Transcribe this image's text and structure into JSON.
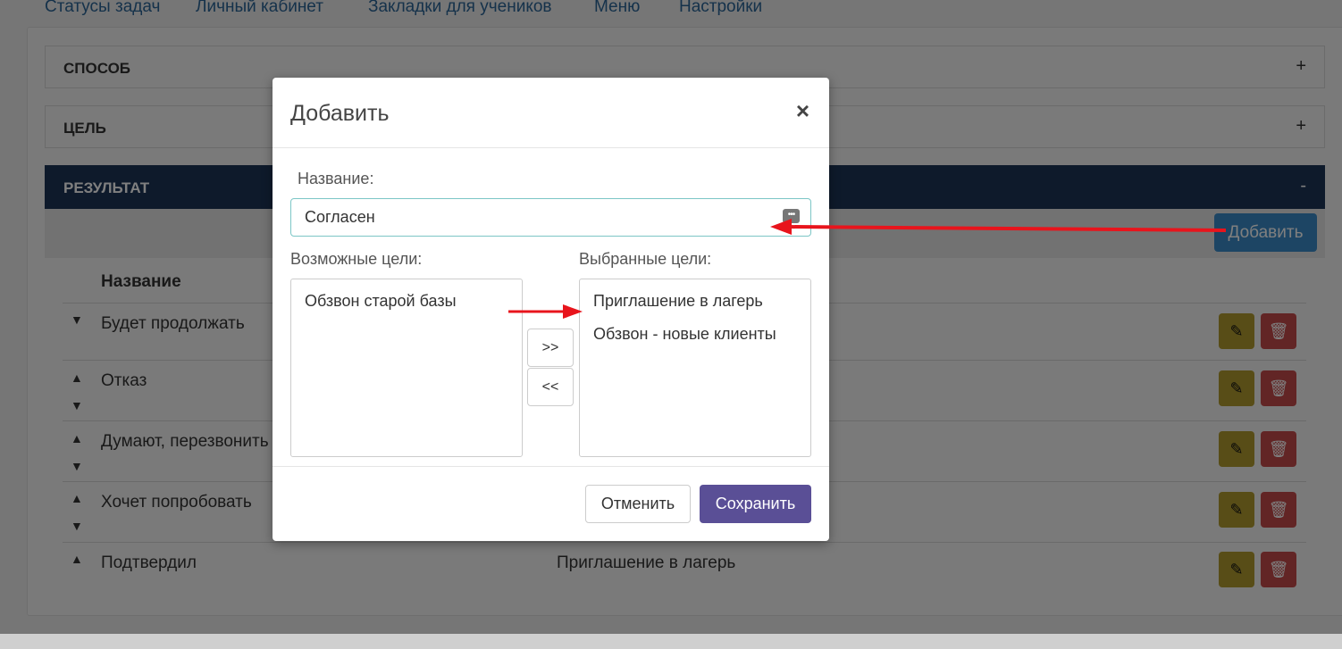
{
  "nav": {
    "items": [
      "Статусы задач",
      "Личный кабинет",
      "Закладки для учеников",
      "Меню",
      "Настройки"
    ]
  },
  "accordion": [
    {
      "title": "СПОСОБ",
      "toggle": "+"
    },
    {
      "title": "ЦЕЛЬ",
      "toggle": "+"
    },
    {
      "title": "РЕЗУЛЬТАТ",
      "toggle": "-"
    }
  ],
  "toolbar": {
    "add_label": "Добавить"
  },
  "table": {
    "header_name": "Название",
    "rows": [
      {
        "name": "Будет продолжать",
        "goal": ""
      },
      {
        "name": "Отказ",
        "goal": ""
      },
      {
        "name": "Думают, перезвонить",
        "goal": ""
      },
      {
        "name": "Хочет попробовать",
        "goal": ""
      },
      {
        "name": "Подтвердил",
        "goal": "Приглашение в лагерь"
      }
    ]
  },
  "modal": {
    "title": "Добавить",
    "close": "×",
    "name_label": "Название:",
    "name_value": "Согласен",
    "available_label": "Возможные цели:",
    "selected_label": "Выбранные цели:",
    "available": [
      "Обзвон старой базы"
    ],
    "selected": [
      "Приглашение в лагерь",
      "Обзвон - новые клиенты"
    ],
    "move_right": ">>",
    "move_left": "<<",
    "cancel_label": "Отменить",
    "save_label": "Сохранить"
  },
  "colors": {
    "accent_dark": "#1c3557",
    "primary_blue": "#3a8bc8",
    "save_purple": "#5a4f96",
    "edit_yellow": "#b09a2e",
    "delete_red": "#c44a4a",
    "annotation_red": "#e8141c"
  }
}
